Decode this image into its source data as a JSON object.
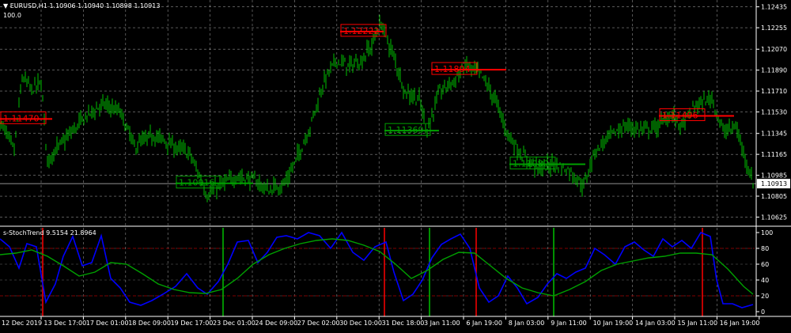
{
  "header": {
    "symbol_line": "EURUSD,H1  1.10906 1.10940 1.10898 1.10913",
    "indicator_line": "s-StochTrend 9.5154 21.8964",
    "panel_max_label": "100.0"
  },
  "colors": {
    "background": "#000000",
    "candle": "#00c000",
    "grid": "#ffffff",
    "label_red": "#ff0000",
    "label_green": "#00a000",
    "stoch_line": "#0000ff",
    "signal_line": "#00a000",
    "level_line": "#800000",
    "sell_vline": "#ff0000",
    "buy_vline": "#00c000"
  },
  "price_axis": {
    "ticks": [
      "1.12435",
      "1.12255",
      "1.12070",
      "1.11890",
      "1.11710",
      "1.11530",
      "1.11345",
      "1.11165",
      "1.10985",
      "1.10805",
      "1.10625"
    ],
    "current": "1.10913",
    "range": [
      1.1056,
      1.1248
    ]
  },
  "indicator_axis": {
    "ticks": [
      "100",
      "80",
      "60",
      "40",
      "20",
      "0"
    ],
    "range": [
      0,
      100
    ],
    "levels": [
      20,
      80
    ]
  },
  "time_axis": [
    "12 Dec 2019",
    "13 Dec 17:00",
    "17 Dec 01:00",
    "18 Dec 09:00",
    "19 Dec 17:00",
    "23 Dec 01:00",
    "24 Dec 09:00",
    "27 Dec 02:00",
    "30 Dec 10:00",
    "31 Dec 18:00",
    "3 Jan 11:00",
    "6 Jan 19:00",
    "8 Jan 03:00",
    "9 Jan 11:00",
    "10 Jan 19:00",
    "14 Jan 03:00",
    "15 Jan 11:00",
    "16 Jan 19:00"
  ],
  "price_labels": [
    {
      "text": "1.11470",
      "kind": "sell",
      "bar": 0,
      "price": 1.1147,
      "line_to_bar": 66
    },
    {
      "text": "1.12222",
      "kind": "sell",
      "bar": 430,
      "price": 1.12222,
      "line_to_bar": 485
    },
    {
      "text": "1.11894",
      "kind": "sell",
      "bar": 545,
      "price": 1.11894,
      "line_to_bar": 640
    },
    {
      "text": "1.11496",
      "kind": "sell",
      "bar": 833,
      "price": 1.11496,
      "line_to_bar": 928
    },
    {
      "text": "1.10916",
      "kind": "buy",
      "bar": 222,
      "price": 1.10916,
      "line_to_bar": 320
    },
    {
      "text": "1.11369",
      "kind": "buy",
      "bar": 486,
      "price": 1.11369,
      "line_to_bar": 555
    },
    {
      "text": "1.11080",
      "kind": "buy",
      "bar": 644,
      "price": 1.1108,
      "line_to_bar": 740
    }
  ],
  "signal_vlines": [
    {
      "kind": "sell",
      "bar": 54
    },
    {
      "kind": "buy",
      "bar": 282
    },
    {
      "kind": "sell",
      "bar": 486
    },
    {
      "kind": "buy",
      "bar": 543
    },
    {
      "kind": "sell",
      "bar": 602
    },
    {
      "kind": "buy",
      "bar": 700
    },
    {
      "kind": "sell",
      "bar": 888
    }
  ],
  "chart_data": [
    {
      "type": "candlestick",
      "title": "EURUSD,H1",
      "ylim": [
        1.1056,
        1.1248
      ],
      "price_path": [
        [
          0,
          1.1144
        ],
        [
          18,
          1.112
        ],
        [
          28,
          1.1183
        ],
        [
          40,
          1.1172
        ],
        [
          52,
          1.1178
        ],
        [
          60,
          1.1112
        ],
        [
          90,
          1.1135
        ],
        [
          110,
          1.115
        ],
        [
          132,
          1.116
        ],
        [
          152,
          1.1152
        ],
        [
          170,
          1.1123
        ],
        [
          195,
          1.1133
        ],
        [
          215,
          1.1125
        ],
        [
          240,
          1.1117
        ],
        [
          262,
          1.1082
        ],
        [
          280,
          1.109
        ],
        [
          300,
          1.1098
        ],
        [
          322,
          1.1094
        ],
        [
          340,
          1.1085
        ],
        [
          360,
          1.1092
        ],
        [
          372,
          1.1108
        ],
        [
          392,
          1.114
        ],
        [
          410,
          1.118
        ],
        [
          425,
          1.1198
        ],
        [
          440,
          1.1192
        ],
        [
          458,
          1.1198
        ],
        [
          470,
          1.121
        ],
        [
          481,
          1.123
        ],
        [
          496,
          1.1204
        ],
        [
          512,
          1.1171
        ],
        [
          530,
          1.1164
        ],
        [
          540,
          1.1138
        ],
        [
          556,
          1.117
        ],
        [
          572,
          1.1179
        ],
        [
          590,
          1.1193
        ],
        [
          608,
          1.1185
        ],
        [
          625,
          1.1165
        ],
        [
          642,
          1.1134
        ],
        [
          660,
          1.1116
        ],
        [
          680,
          1.1104
        ],
        [
          700,
          1.1108
        ],
        [
          720,
          1.1103
        ],
        [
          738,
          1.1089
        ],
        [
          752,
          1.1119
        ],
        [
          770,
          1.1132
        ],
        [
          790,
          1.1141
        ],
        [
          810,
          1.1138
        ],
        [
          830,
          1.114
        ],
        [
          848,
          1.115
        ],
        [
          862,
          1.1141
        ],
        [
          880,
          1.1159
        ],
        [
          900,
          1.1165
        ],
        [
          915,
          1.1135
        ],
        [
          930,
          1.1141
        ],
        [
          944,
          1.111
        ],
        [
          952,
          1.1091
        ]
      ],
      "current_price": 1.10913
    },
    {
      "type": "line",
      "title": "s-StochTrend",
      "ylim": [
        0,
        100
      ],
      "series": [
        {
          "name": "s-StochTrend",
          "color": "#0000ff",
          "values": [
            [
              0,
              92
            ],
            [
              12,
              82
            ],
            [
              24,
              55
            ],
            [
              34,
              86
            ],
            [
              46,
              82
            ],
            [
              58,
              12
            ],
            [
              70,
              35
            ],
            [
              80,
              70
            ],
            [
              92,
              95
            ],
            [
              104,
              58
            ],
            [
              116,
              62
            ],
            [
              128,
              96
            ],
            [
              140,
              42
            ],
            [
              152,
              30
            ],
            [
              164,
              12
            ],
            [
              178,
              8
            ],
            [
              192,
              14
            ],
            [
              206,
              22
            ],
            [
              222,
              32
            ],
            [
              236,
              48
            ],
            [
              250,
              30
            ],
            [
              262,
              22
            ],
            [
              276,
              38
            ],
            [
              288,
              60
            ],
            [
              300,
              88
            ],
            [
              314,
              90
            ],
            [
              326,
              62
            ],
            [
              338,
              75
            ],
            [
              350,
              94
            ],
            [
              362,
              96
            ],
            [
              376,
              92
            ],
            [
              390,
              100
            ],
            [
              404,
              96
            ],
            [
              418,
              80
            ],
            [
              432,
              100
            ],
            [
              446,
              75
            ],
            [
              460,
              65
            ],
            [
              474,
              82
            ],
            [
              488,
              88
            ],
            [
              498,
              50
            ],
            [
              510,
              14
            ],
            [
              522,
              22
            ],
            [
              534,
              40
            ],
            [
              546,
              68
            ],
            [
              558,
              85
            ],
            [
              570,
              92
            ],
            [
              582,
              98
            ],
            [
              594,
              80
            ],
            [
              606,
              30
            ],
            [
              618,
              12
            ],
            [
              630,
              20
            ],
            [
              642,
              45
            ],
            [
              654,
              30
            ],
            [
              666,
              10
            ],
            [
              680,
              18
            ],
            [
              692,
              35
            ],
            [
              704,
              48
            ],
            [
              716,
              42
            ],
            [
              728,
              50
            ],
            [
              740,
              55
            ],
            [
              752,
              80
            ],
            [
              764,
              72
            ],
            [
              778,
              60
            ],
            [
              790,
              82
            ],
            [
              802,
              88
            ],
            [
              814,
              78
            ],
            [
              826,
              70
            ],
            [
              838,
              92
            ],
            [
              850,
              82
            ],
            [
              862,
              90
            ],
            [
              874,
              80
            ],
            [
              886,
              100
            ],
            [
              898,
              95
            ],
            [
              906,
              40
            ],
            [
              914,
              10
            ],
            [
              926,
              10
            ],
            [
              938,
              5
            ],
            [
              952,
              9
            ]
          ]
        },
        {
          "name": "signal",
          "color": "#00a000",
          "values": [
            [
              0,
              72
            ],
            [
              20,
              74
            ],
            [
              40,
              78
            ],
            [
              60,
              70
            ],
            [
              80,
              58
            ],
            [
              100,
              45
            ],
            [
              120,
              50
            ],
            [
              140,
              62
            ],
            [
              160,
              60
            ],
            [
              180,
              48
            ],
            [
              200,
              35
            ],
            [
              220,
              28
            ],
            [
              240,
              24
            ],
            [
              260,
              23
            ],
            [
              280,
              28
            ],
            [
              300,
              42
            ],
            [
              320,
              60
            ],
            [
              340,
              72
            ],
            [
              360,
              80
            ],
            [
              380,
              86
            ],
            [
              400,
              90
            ],
            [
              420,
              92
            ],
            [
              440,
              90
            ],
            [
              460,
              84
            ],
            [
              480,
              76
            ],
            [
              500,
              60
            ],
            [
              520,
              42
            ],
            [
              540,
              52
            ],
            [
              560,
              66
            ],
            [
              580,
              75
            ],
            [
              600,
              74
            ],
            [
              620,
              58
            ],
            [
              640,
              42
            ],
            [
              660,
              30
            ],
            [
              680,
              24
            ],
            [
              700,
              20
            ],
            [
              720,
              28
            ],
            [
              740,
              38
            ],
            [
              760,
              52
            ],
            [
              780,
              60
            ],
            [
              800,
              64
            ],
            [
              820,
              68
            ],
            [
              840,
              70
            ],
            [
              860,
              74
            ],
            [
              880,
              74
            ],
            [
              900,
              72
            ],
            [
              920,
              54
            ],
            [
              940,
              32
            ],
            [
              952,
              22
            ]
          ]
        }
      ]
    }
  ]
}
